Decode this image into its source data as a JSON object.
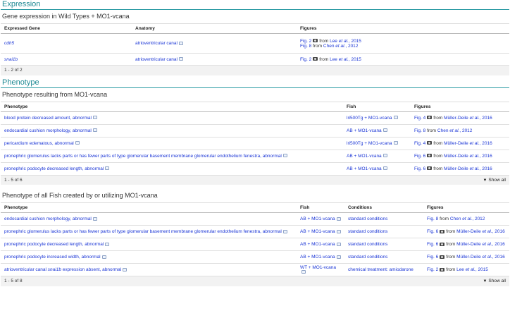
{
  "expression": {
    "title": "Expression",
    "subtitle": "Gene expression in Wild Types + MO1-vcana",
    "headers": [
      "Expressed Gene",
      "Anatomy",
      "Figures"
    ],
    "rows": [
      {
        "gene": "cdh5",
        "anatomy": "atrioventricular canal",
        "figs": [
          {
            "fig": "Fig. 2",
            "cam": true,
            "from": "from",
            "author": "Lee",
            "etal": "et al.",
            "year": ", 2015"
          },
          {
            "fig": "Fig. 8",
            "cam": false,
            "from": "from",
            "author": "Chen",
            "etal": "et al.",
            "year": ", 2012"
          }
        ]
      },
      {
        "gene": "snai1b",
        "anatomy": "atrioventricular canal",
        "figs": [
          {
            "fig": "Fig. 2",
            "cam": true,
            "from": "from",
            "author": "Lee",
            "etal": "et al.",
            "year": ", 2015"
          }
        ]
      }
    ],
    "footer": "1 - 2 of 2"
  },
  "phenotype": {
    "title": "Phenotype",
    "subtitle": "Phenotype resulting from MO1-vcana",
    "headers": [
      "Phenotype",
      "Fish",
      "Figures"
    ],
    "rows": [
      {
        "phenotype": "blood protein decreased amount, abnormal",
        "fish": "Tg + MO1-vcana",
        "fish_prefix": "lri500",
        "fig": "Fig. 4",
        "cam": true,
        "author": "Müller-Deile",
        "etal": "et al.",
        "year": ", 2016"
      },
      {
        "phenotype": "endocardial cushion morphology, abnormal",
        "fish": "AB + MO1-vcana",
        "fish_prefix": "",
        "fig": "Fig. 8",
        "cam": false,
        "author": "Chen",
        "etal": "et al.",
        "year": ", 2012"
      },
      {
        "phenotype": "pericardium edematous, abnormal",
        "fish": "Tg + MO1-vcana",
        "fish_prefix": "lri500",
        "fig": "Fig. 4",
        "cam": true,
        "author": "Müller-Deile",
        "etal": "et al.",
        "year": ", 2016"
      },
      {
        "phenotype": "pronephric glomerulus lacks parts or has fewer parts of type glomerular basement membrane glomerular endothelium fenestra, abnormal",
        "fish": "AB + MO1-vcana",
        "fish_prefix": "",
        "fig": "Fig. 6",
        "cam": true,
        "author": "Müller-Deile",
        "etal": "et al.",
        "year": ", 2016"
      },
      {
        "phenotype": "pronephric podocyte decreased length, abnormal",
        "fish": "AB + MO1-vcana",
        "fish_prefix": "",
        "fig": "Fig. 6",
        "cam": true,
        "author": "Müller-Deile",
        "etal": "et al.",
        "year": ", 2016"
      }
    ],
    "footer": "1 - 5 of 6",
    "show_all": "Show all"
  },
  "phenotype_all": {
    "subtitle": "Phenotype of all Fish created by or utilizing MO1-vcana",
    "headers": [
      "Phenotype",
      "Fish",
      "Conditions",
      "Figures"
    ],
    "rows": [
      {
        "phenotype": "endocardial cushion morphology, abnormal",
        "fish": "AB + MO1-vcana",
        "condition": "standard conditions",
        "fig": "Fig. 8",
        "cam": false,
        "author": "Chen",
        "etal": "et al.",
        "year": ", 2012"
      },
      {
        "phenotype": "pronephric glomerulus lacks parts or has fewer parts of type glomerular basement membrane glomerular endothelium fenestra, abnormal",
        "fish": "AB + MO1-vcana",
        "condition": "standard conditions",
        "fig": "Fig. 6",
        "cam": true,
        "author": "Müller-Deile",
        "etal": "et al.",
        "year": ", 2016"
      },
      {
        "phenotype": "pronephric podocyte decreased length, abnormal",
        "fish": "AB + MO1-vcana",
        "condition": "standard conditions",
        "fig": "Fig. 6",
        "cam": true,
        "author": "Müller-Deile",
        "etal": "et al.",
        "year": ", 2016"
      },
      {
        "phenotype": "pronephric podocyte increased width, abnormal",
        "fish": "AB + MO1-vcana",
        "condition": "standard conditions",
        "fig": "Fig. 6",
        "cam": true,
        "author": "Müller-Deile",
        "etal": "et al.",
        "year": ", 2016"
      },
      {
        "phenotype_pre": "atrioventricular canal ",
        "phenotype_gene": "snai1b",
        "phenotype_post": " expression absent, abnormal",
        "fish": "WT + MO1-vcana",
        "condition": "chemical treatment: amiodarone",
        "fig": "Fig. 2",
        "cam": true,
        "author": "Lee",
        "etal": "et al.",
        "year": ", 2015"
      }
    ],
    "footer": "1 - 5 of 8",
    "show_all": "Show all"
  }
}
